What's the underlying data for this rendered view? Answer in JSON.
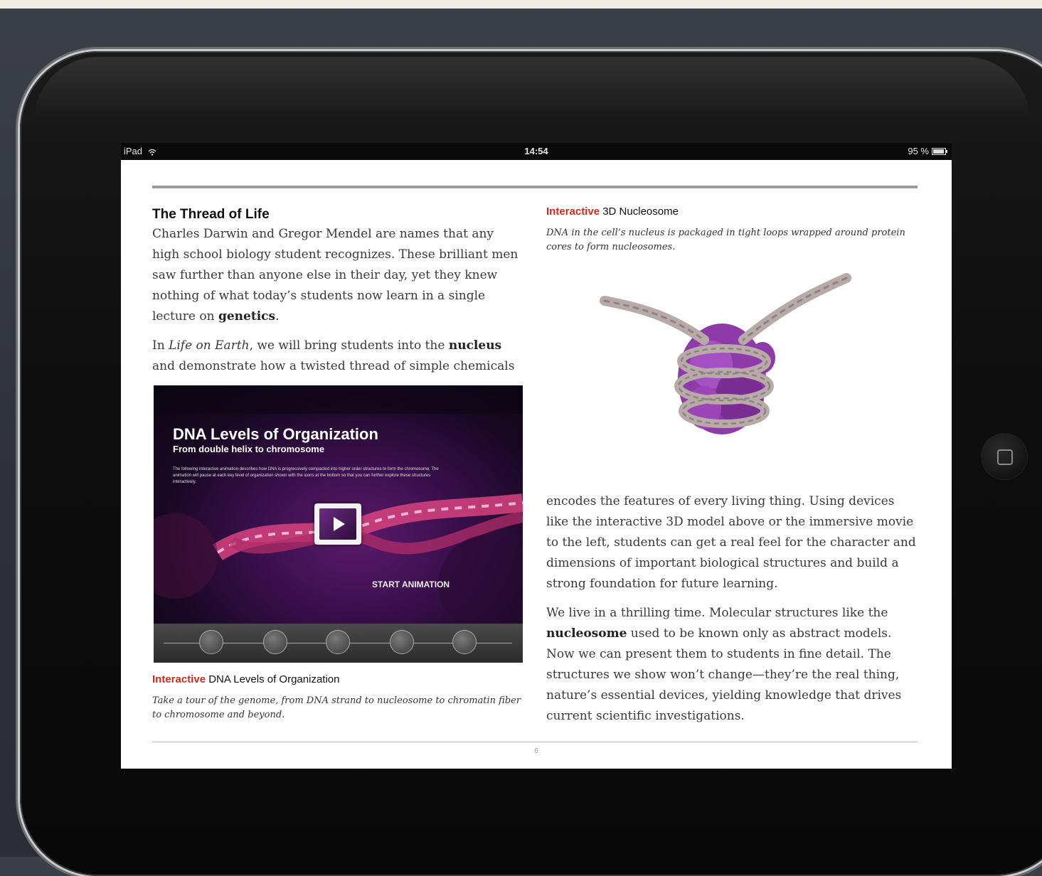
{
  "status_bar": {
    "device": "iPad",
    "time": "14:54",
    "battery": "95 %"
  },
  "left": {
    "title": "The Thread of Life",
    "para1_a": "Charles Darwin and Gregor Mendel are names that any high school biology student recognizes. These brilliant men saw further than anyone else in their day, yet they knew nothing of what today’s students now learn in a single lecture on ",
    "para1_bold": "genetics",
    "para1_end": ".",
    "para2_a": "In ",
    "para2_italic": "Life on Earth",
    "para2_b": ", we will bring students into the ",
    "para2_bold": "nucleus",
    "para2_c": " and demonstrate how a twisted thread of simple chemicals"
  },
  "video": {
    "title": "DNA Levels of Organization",
    "subtitle": "From double helix to chromosome",
    "description": "The following interactive animation describes how DNA is progressively compacted into higher order structures to form the chromosome. The animation will pause at each key level of organization shown with the icons at the bottom so that you can further explore these structures interactively.",
    "start_label": "START ANIMATION",
    "stages": [
      "double-helix",
      "nucleosome",
      "chromatin-fiber",
      "chromosome",
      "beyond"
    ]
  },
  "caption_left": {
    "accent": "Interactive",
    "label": " DNA Levels of Organization",
    "desc": "Take a tour of the genome, from DNA strand to nucleosome to chromatin fiber to chromosome and beyond."
  },
  "caption_right": {
    "accent": "Interactive",
    "label": " 3D Nucleosome",
    "desc": "DNA in the cell’s nucleus is packaged in tight loops wrapped around protein cores to form nucleosomes."
  },
  "right": {
    "para1": "encodes the features of every living thing. Using devices like the interactive 3D model above or the immersive movie to the left, students can get a real feel for the character and dimensions of important biological structures and build a strong foundation for future learning.",
    "para2_a": "We live in a thrilling time. Molecular structures like the ",
    "para2_bold": "nucleosome",
    "para2_b": " used to be known only as abstract models. Now we can present them to students in fine detail. The structures we show won’t change—they’re the real thing, nature’s essential devices, yielding knowledge that drives current scientific investigations."
  },
  "page_number": "6",
  "colors": {
    "accent": "#d22a1a",
    "protein": "#8e3aa8",
    "dna": "#b7aaa8"
  }
}
